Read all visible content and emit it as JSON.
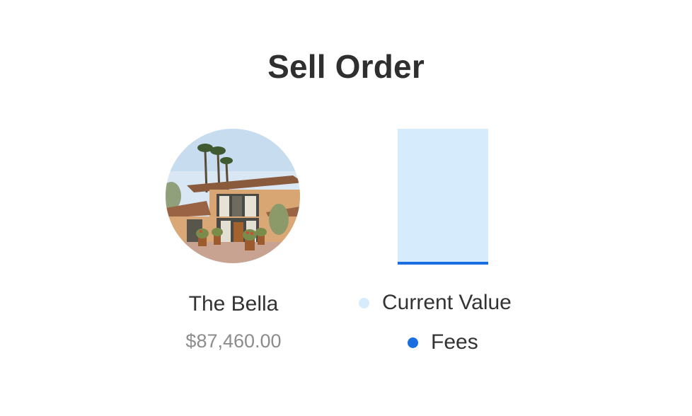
{
  "page": {
    "title": "Sell Order"
  },
  "property": {
    "name": "The Bella",
    "price": "$87,460.00"
  },
  "chart_data": {
    "type": "bar",
    "categories": [
      ""
    ],
    "series": [
      {
        "name": "Current Value",
        "values": [
          87460.0
        ]
      },
      {
        "name": "Fees",
        "values": [
          1
        ]
      }
    ],
    "title": "",
    "xlabel": "",
    "ylabel": "",
    "stacked": true,
    "grid": false,
    "legend": "bottom"
  },
  "legend": {
    "items": [
      {
        "label": "Current Value",
        "color": "#d6ebfb"
      },
      {
        "label": "Fees",
        "color": "#1a6fe0"
      }
    ]
  },
  "colors": {
    "current_value": "#d6ebfb",
    "fees": "#1a6fe0",
    "title": "#2f2f2f",
    "price": "#8c8c8c"
  }
}
